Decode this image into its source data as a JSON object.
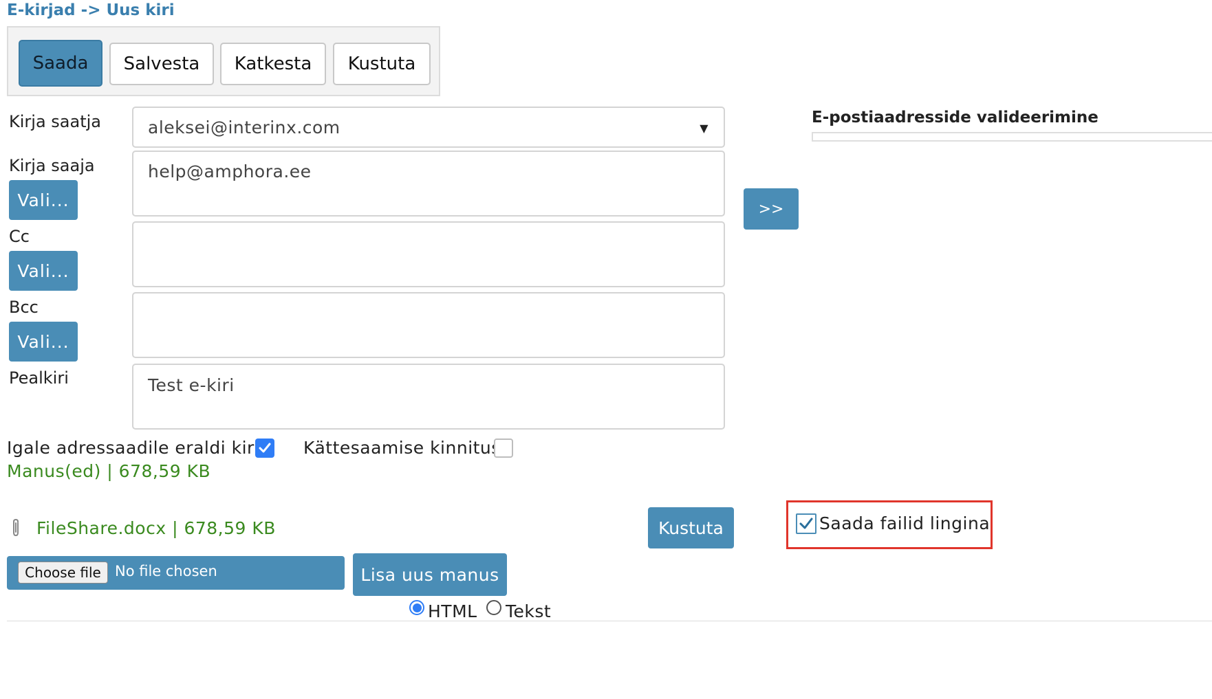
{
  "breadcrumb": "E-kirjad -> Uus kiri",
  "toolbar": {
    "send_label": "Saada",
    "save_label": "Salvesta",
    "cancel_label": "Katkesta",
    "delete_label": "Kustuta"
  },
  "form": {
    "sender_label": "Kirja saatja",
    "sender_value": "aleksei@interinx.com",
    "recipient_label": "Kirja saaja",
    "recipient_value": "help@amphora.ee",
    "cc_label": "Cc",
    "cc_value": "",
    "bcc_label": "Bcc",
    "bcc_value": "",
    "subject_label": "Pealkiri",
    "subject_value": "Test e-kiri",
    "choose_label": "Vali..."
  },
  "move_button_label": ">>",
  "validation": {
    "title": "E-postiaadresside valideerimine"
  },
  "options": {
    "separate_label": "Igale adressaadile eraldi kiri",
    "separate_checked": true,
    "receipt_label": "Kättesaamise kinnitus",
    "receipt_checked": false
  },
  "attachments": {
    "summary": "Manus(ed) | 678,59 KB",
    "files": [
      {
        "name": "FileShare.docx | 678,59 KB",
        "delete_label": "Kustuta"
      }
    ],
    "send_as_link_label": "Saada failid lingina",
    "send_as_link_checked": true,
    "choose_file_label": "Choose file",
    "no_file_label": "No file chosen",
    "add_label": "Lisa uus manus"
  },
  "format": {
    "html_label": "HTML",
    "text_label": "Tekst",
    "selected": "HTML"
  },
  "colors": {
    "accent": "#4a8db6",
    "link": "#3a7fae",
    "success": "#3a8a1f",
    "highlight": "#e0352b"
  }
}
